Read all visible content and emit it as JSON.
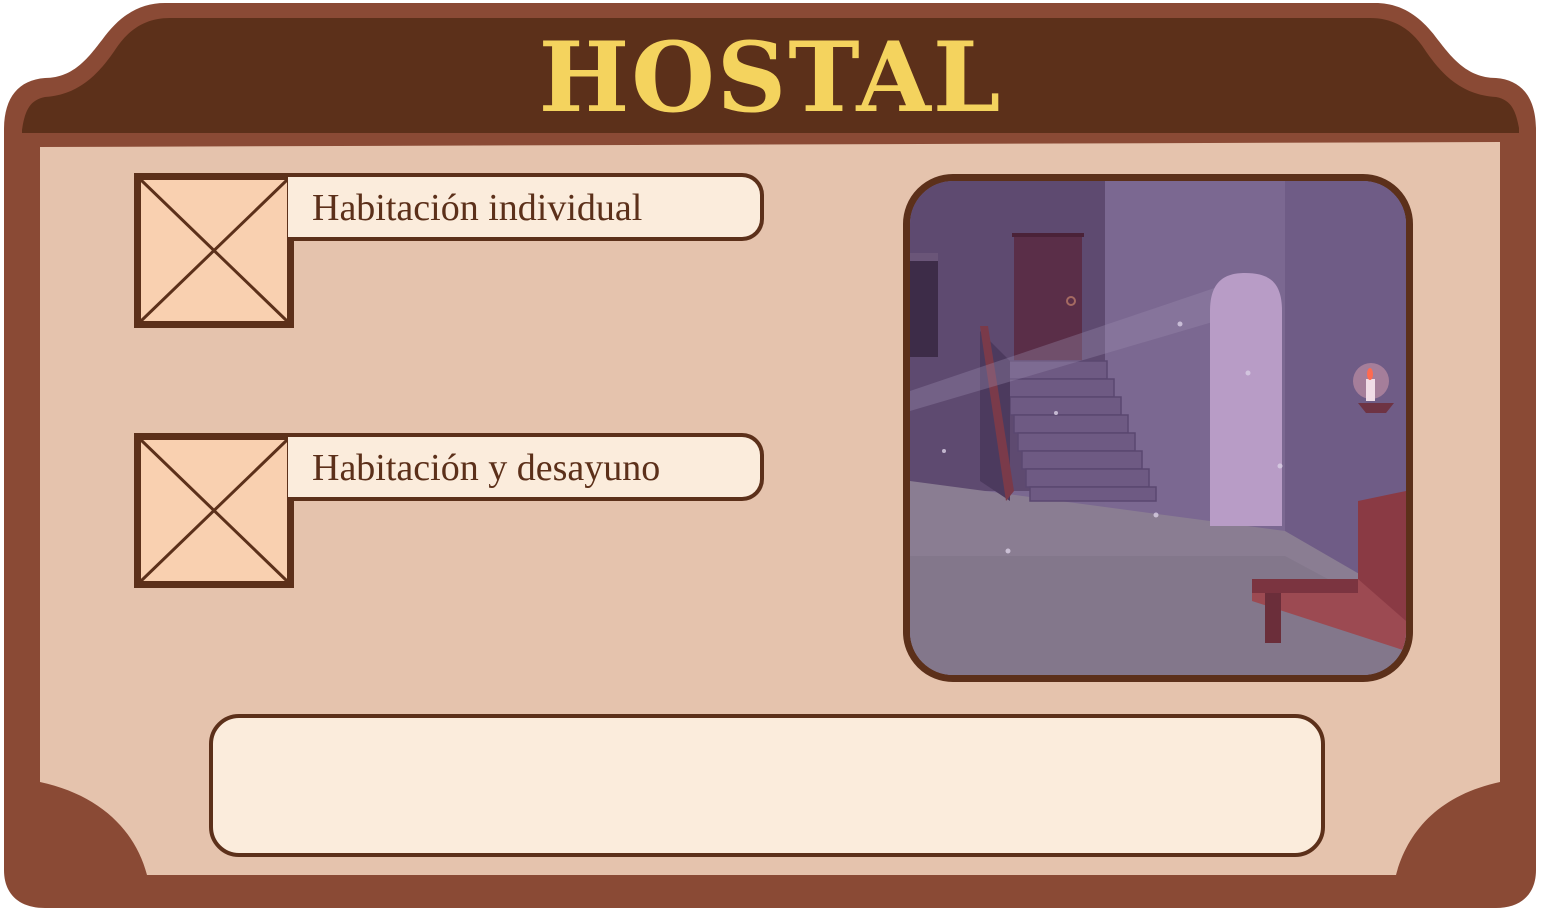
{
  "title": "HOSTAL",
  "options": [
    {
      "label": "Habitación individual",
      "checked": false
    },
    {
      "label": "Habitación y desayuno",
      "checked": false
    }
  ],
  "message": "",
  "scene": {
    "icon": "hostel-lobby-illustration"
  },
  "colors": {
    "frame_outer": "#8a4a35",
    "header": "#5c301a",
    "panel": "#e5c3ad",
    "title": "#f4d35e",
    "checkbox_fill": "#f9d0b0",
    "label_bg": "#fbecdc",
    "outline": "#5c301a"
  }
}
